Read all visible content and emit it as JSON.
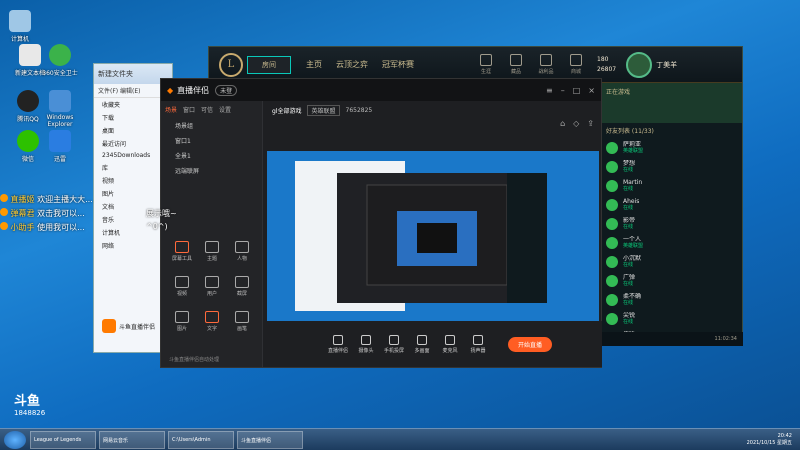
{
  "desktop": {
    "icons": [
      {
        "label": "计算机"
      },
      {
        "label": "新建文本档"
      },
      {
        "label": "360安全卫士"
      },
      {
        "label": "腾讯QQ"
      },
      {
        "label": "Windows Explorer"
      },
      {
        "label": "微信"
      },
      {
        "label": "迅雷"
      }
    ]
  },
  "chat": {
    "lines": [
      {
        "user": "直播姬",
        "text": "欢迎主播大大..."
      },
      {
        "user": "弹幕君",
        "text": "双击我可以..."
      },
      {
        "user": "小助手",
        "text": "使用我可以..."
      }
    ],
    "overlay1": "展示哦~",
    "overlay2": "^0^)"
  },
  "douyu_logo_text": "斗鱼",
  "douyu_id": "1848826",
  "explorer": {
    "title": "新建文件夹",
    "menu": "文件(F)  编辑(E)",
    "tree": [
      "收藏夹",
      "下载",
      "桌面",
      "最近访问",
      "2345Downloads",
      "库",
      "视频",
      "图片",
      "文档",
      "音乐",
      "计算机",
      "网络"
    ],
    "bottom_label": "斗鱼直播伴侣"
  },
  "lol": {
    "logo": "L",
    "play_label": "房间",
    "nav": [
      "主页",
      "云顶之弈",
      "冠军杯赛"
    ],
    "icon_buttons": [
      "生涯",
      "藏品",
      "战利品",
      "商城"
    ],
    "currency_be": "180",
    "currency_rp": "26807",
    "username": "丁美羊",
    "social_title": "正在游戏",
    "friends_header": "好友列表 (11/33)",
    "friends": [
      {
        "name": "萨莉亚",
        "status": "英雄联盟"
      },
      {
        "name": "梦想",
        "status": "在线"
      },
      {
        "name": "Martin",
        "status": "在线"
      },
      {
        "name": "Aheis",
        "status": "在线"
      },
      {
        "name": "影帝",
        "status": "在线"
      },
      {
        "name": "一个人",
        "status": "英雄联盟"
      },
      {
        "name": "小沉默",
        "status": "在线"
      },
      {
        "name": "广弹",
        "status": "在线"
      },
      {
        "name": "柔不确",
        "status": "在线"
      },
      {
        "name": "尖锐",
        "status": "在线"
      },
      {
        "name": "伍所",
        "status": "在线"
      },
      {
        "name": "丸丸",
        "status": "在线"
      }
    ],
    "bottom_time": "11:02:34"
  },
  "douyu": {
    "title": "直播伴侣",
    "badge": "未登",
    "tabs": [
      "场景",
      "窗口",
      "可信",
      "设置"
    ],
    "scenes": [
      "场景组",
      "窗口1",
      "全景1",
      "远端联屏"
    ],
    "tools": [
      "屏幕工具",
      "主题",
      "人物",
      "视频",
      "用户",
      "截屏",
      "图片",
      "文字",
      "画笔",
      "场景管理",
      "帮助"
    ],
    "room_title": "gl全部游戏",
    "category": "英雄联盟",
    "room_id": "7652825",
    "bottom_buttons": [
      "直播伴侣",
      "摄像头",
      "手机投屏",
      "多画面",
      "麦克风",
      "扬声器"
    ],
    "start_label": "开始直播",
    "bottom_hint": "斗鱼直播伴侣自动处理"
  },
  "taskbar": {
    "items": [
      "League of Legends",
      "网易云音乐",
      "C:\\Users\\Admin",
      "斗鱼直播伴侣"
    ],
    "time": "20:42",
    "date": "2021/10/15 星期五"
  },
  "colors": {
    "desktop_bg": "#1f86d6",
    "lol_gold": "#c8aa6e",
    "douyu_orange": "#ff5d23",
    "online_green": "#0acb7a"
  }
}
